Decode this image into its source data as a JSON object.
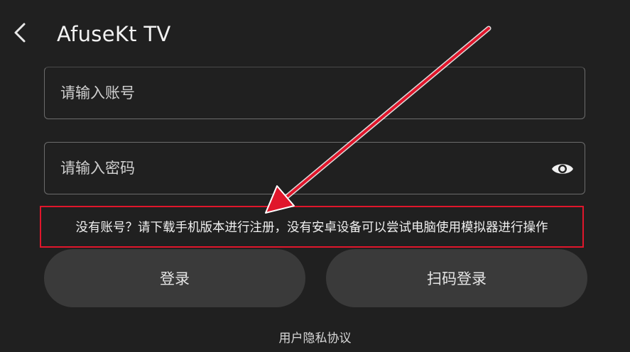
{
  "header": {
    "title": "AfuseKt TV"
  },
  "form": {
    "account_placeholder": "请输入账号",
    "password_placeholder": "请输入密码"
  },
  "hint": {
    "text": "没有账号？请下载手机版本进行注册，没有安卓设备可以尝试电脑使用模拟器进行操作"
  },
  "buttons": {
    "login_label": "登录",
    "qr_login_label": "扫码登录"
  },
  "footer": {
    "privacy_label": "用户隐私协议"
  },
  "colors": {
    "background": "#202020",
    "annotation_red": "#e0162b",
    "button_fill": "#3a3a3a"
  },
  "icons": {
    "back": "chevron-left-icon",
    "password_toggle": "eye-icon"
  }
}
